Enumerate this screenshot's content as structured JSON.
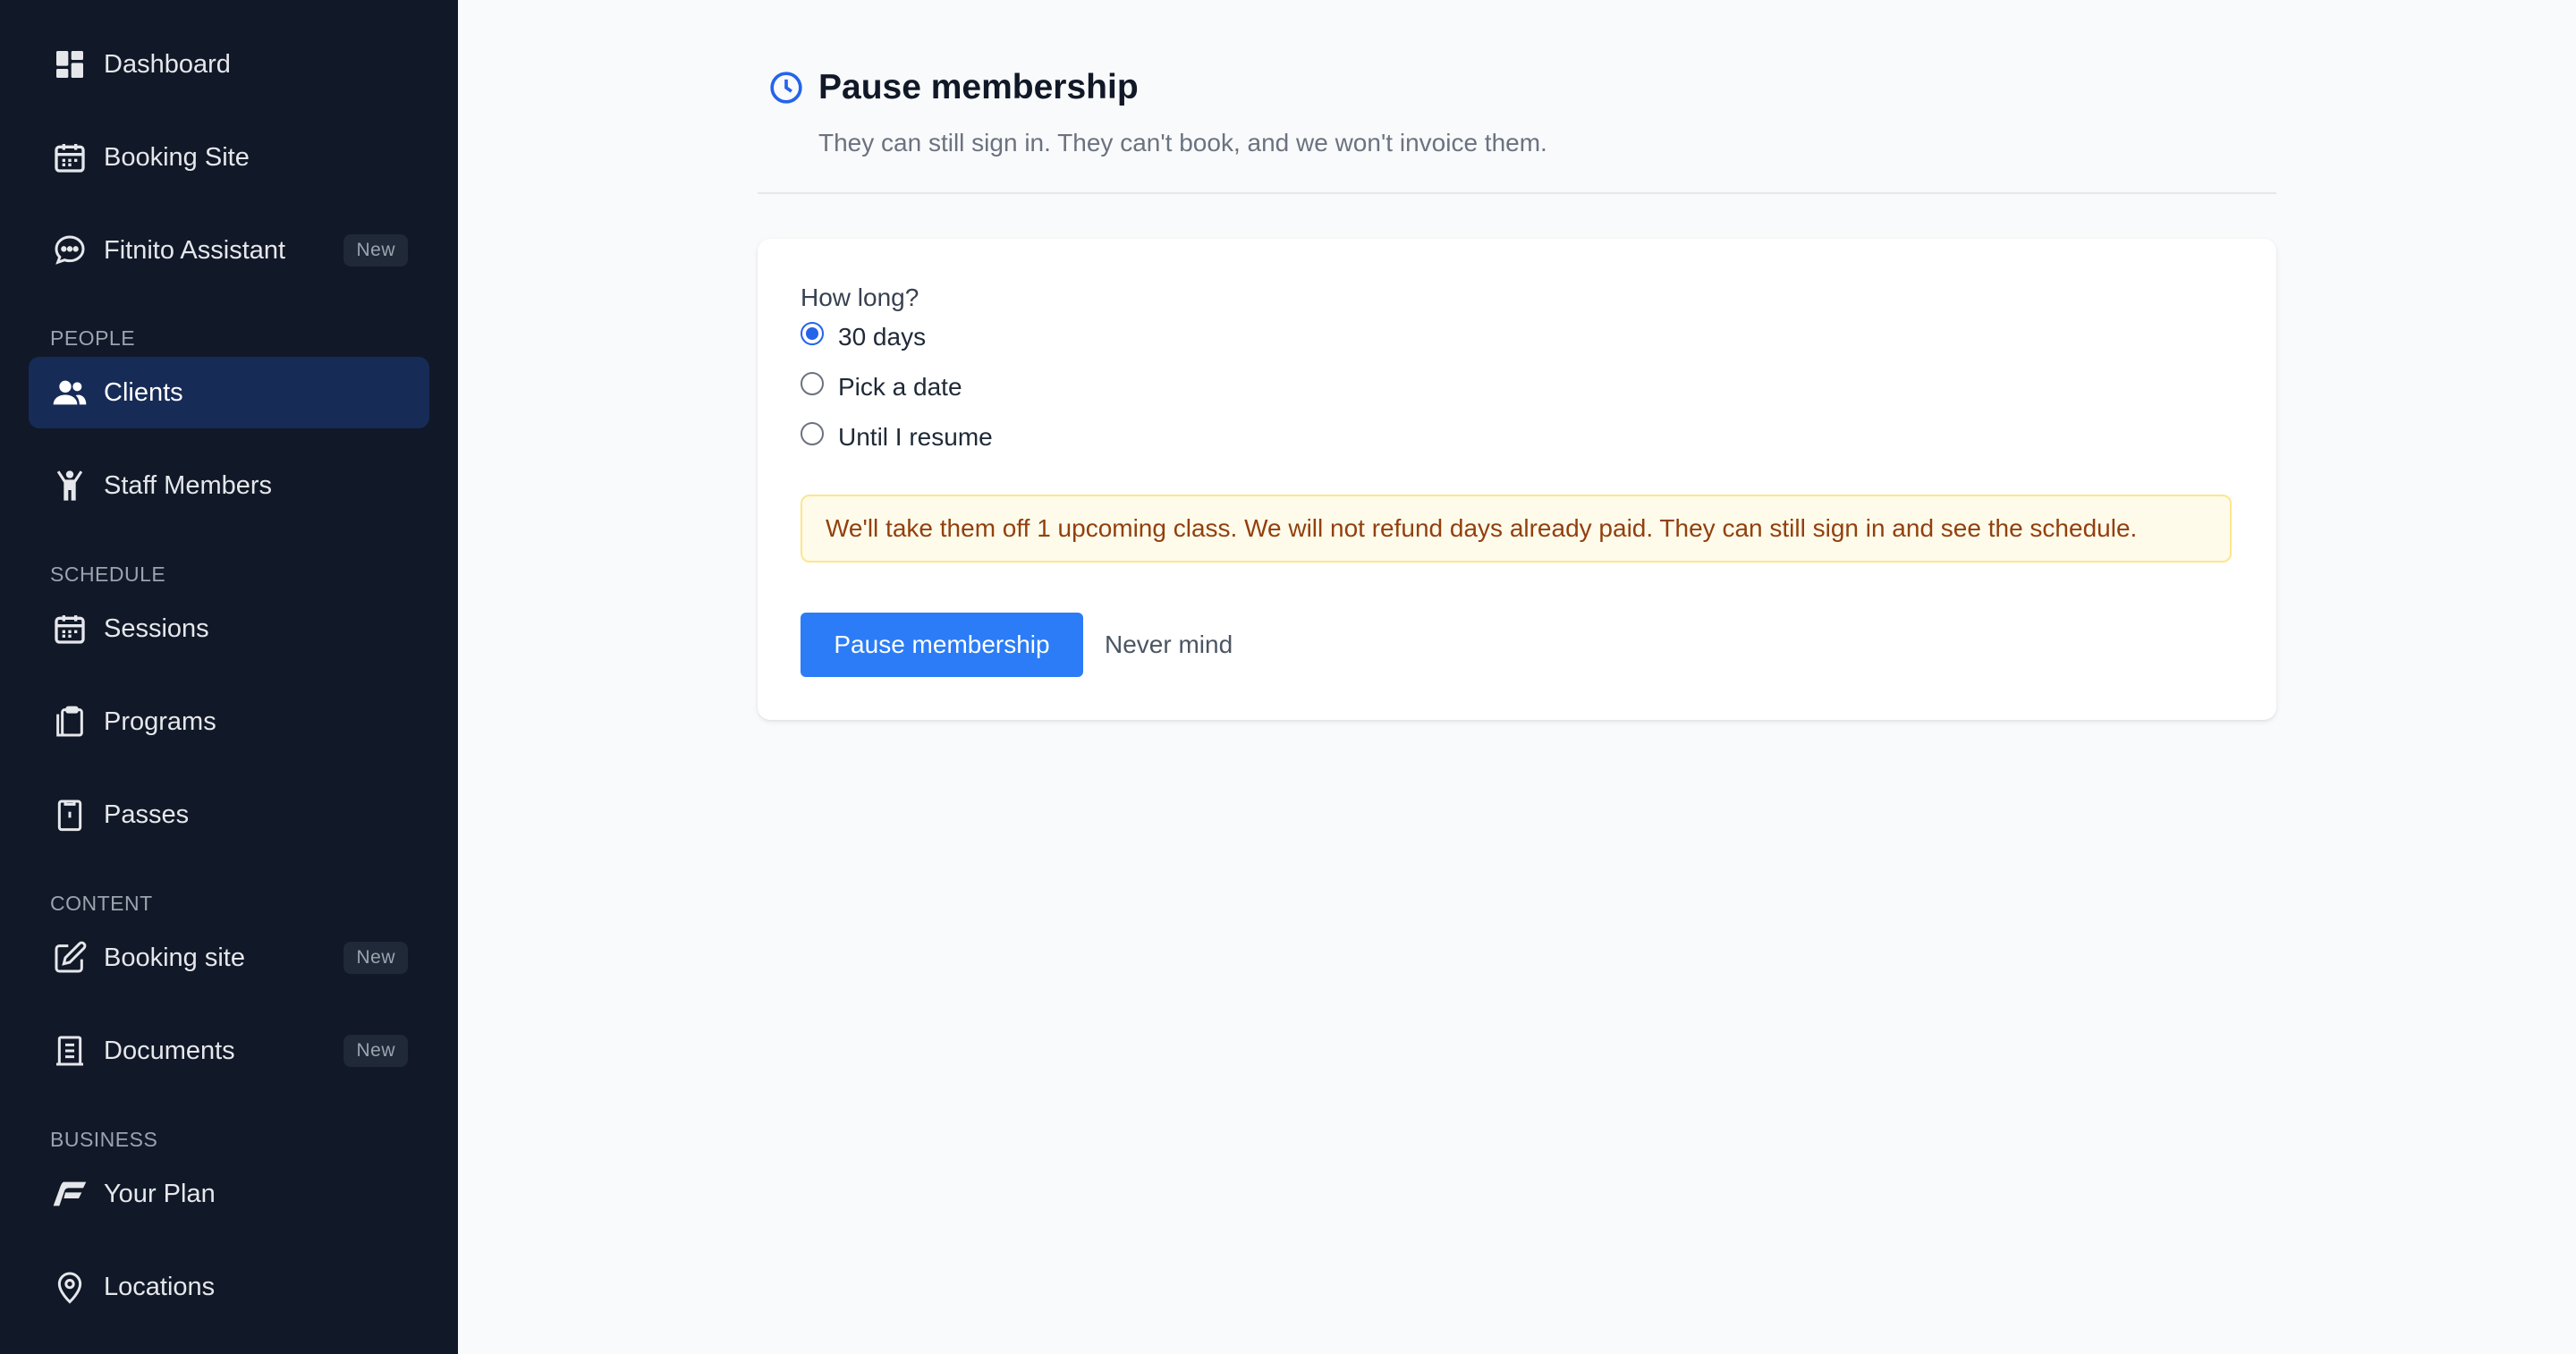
{
  "sidebar": {
    "items": [
      {
        "label": "Dashboard",
        "icon": "dashboard-icon"
      },
      {
        "label": "Booking Site",
        "icon": "calendar-icon"
      },
      {
        "label": "Fitnito Assistant",
        "icon": "chat-icon",
        "badge": "New"
      },
      {
        "label": "Clients",
        "icon": "users-icon",
        "active": true
      },
      {
        "label": "Staff Members",
        "icon": "person-icon"
      },
      {
        "label": "Sessions",
        "icon": "calendar-icon"
      },
      {
        "label": "Programs",
        "icon": "clipboard-copy-icon"
      },
      {
        "label": "Passes",
        "icon": "clipboard-icon"
      },
      {
        "label": "Booking site",
        "icon": "edit-icon",
        "badge": "New"
      },
      {
        "label": "Documents",
        "icon": "document-icon",
        "badge": "New"
      },
      {
        "label": "Your Plan",
        "icon": "brand-f-icon"
      },
      {
        "label": "Locations",
        "icon": "location-pin-icon"
      }
    ],
    "sections": [
      "PEOPLE",
      "SCHEDULE",
      "CONTENT",
      "BUSINESS"
    ]
  },
  "page": {
    "title": "Pause membership",
    "subtitle": "They can still sign in. They can't book, and we won't invoice them."
  },
  "form": {
    "question": "How long?",
    "options": [
      {
        "label": "30 days",
        "checked": true
      },
      {
        "label": "Pick a date",
        "checked": false
      },
      {
        "label": "Until I resume",
        "checked": false
      }
    ],
    "notice": "We'll take them off 1 upcoming class. We will not refund days already paid. They can still sign in and see the schedule.",
    "submit_label": "Pause membership",
    "cancel_label": "Never mind"
  },
  "colors": {
    "sidebar_bg": "#111827",
    "active_item_bg": "#172b57",
    "primary": "#2b7cf6",
    "notice_bg": "#fffbeb",
    "notice_text": "#92400e"
  }
}
